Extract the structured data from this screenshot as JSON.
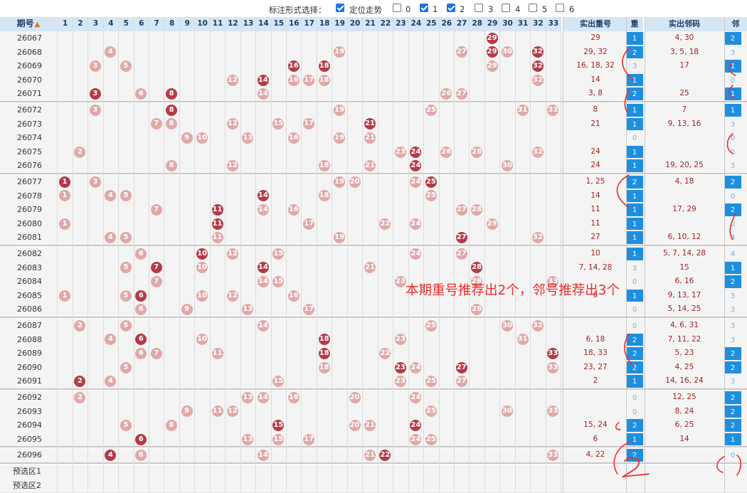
{
  "toolbar": {
    "label": "标注形式选择：",
    "options": [
      {
        "label": "定位走势",
        "checked": true
      },
      {
        "label": "0",
        "checked": false
      },
      {
        "label": "1",
        "checked": true
      },
      {
        "label": "2",
        "checked": true
      },
      {
        "label": "3",
        "checked": false
      },
      {
        "label": "4",
        "checked": false
      },
      {
        "label": "5",
        "checked": false
      },
      {
        "label": "6",
        "checked": false
      }
    ]
  },
  "header": {
    "period": "期号",
    "numbers": [
      "1",
      "2",
      "3",
      "4",
      "5",
      "6",
      "7",
      "8",
      "9",
      "10",
      "11",
      "12",
      "13",
      "14",
      "15",
      "16",
      "17",
      "18",
      "19",
      "20",
      "21",
      "22",
      "23",
      "24",
      "25",
      "26",
      "27",
      "28",
      "29",
      "30",
      "31",
      "32",
      "33"
    ],
    "repeat_nums": "实出重号",
    "repeat": "重",
    "adjacent_nums": "实出邻码",
    "adjacent": "邻"
  },
  "rows": [
    {
      "period": "26067",
      "light": [],
      "dark": [
        29
      ],
      "repeat_nums": "29",
      "repeat": "1",
      "adj_nums": "4, 30",
      "adj": "2",
      "group_end": false
    },
    {
      "period": "26068",
      "light": [
        4,
        19,
        27,
        30
      ],
      "dark": [
        29,
        32
      ],
      "repeat_nums": "29, 32",
      "repeat": "2",
      "adj_nums": "3, 5, 18",
      "adj": "3",
      "group_end": false
    },
    {
      "period": "26069",
      "light": [
        3,
        5,
        29
      ],
      "dark": [
        16,
        18,
        32
      ],
      "repeat_nums": "16, 18, 32",
      "repeat": "3",
      "adj_nums": "17",
      "adj": "1",
      "group_end": false
    },
    {
      "period": "26070",
      "light": [
        12,
        16,
        17,
        18,
        32
      ],
      "dark": [
        14
      ],
      "repeat_nums": "14",
      "repeat": "1",
      "adj_nums": "",
      "adj": "0",
      "group_end": false
    },
    {
      "period": "26071",
      "light": [
        6,
        14,
        26,
        27
      ],
      "dark": [
        3,
        8
      ],
      "repeat_nums": "3, 8",
      "repeat": "2",
      "adj_nums": "25",
      "adj": "1",
      "group_end": true
    },
    {
      "period": "26072",
      "light": [
        3,
        19,
        25,
        31,
        33
      ],
      "dark": [
        8
      ],
      "repeat_nums": "8",
      "repeat": "1",
      "adj_nums": "7",
      "adj": "1",
      "group_end": false
    },
    {
      "period": "26073",
      "light": [
        7,
        8,
        12,
        15,
        17
      ],
      "dark": [
        21
      ],
      "repeat_nums": "21",
      "repeat": "1",
      "adj_nums": "9, 13, 16",
      "adj": "3",
      "group_end": false
    },
    {
      "period": "26074",
      "light": [
        9,
        10,
        13,
        16,
        19,
        21
      ],
      "dark": [],
      "repeat_nums": "",
      "repeat": "0",
      "adj_nums": "",
      "adj": "0",
      "group_end": false
    },
    {
      "period": "26075",
      "light": [
        2,
        23,
        26,
        28,
        32
      ],
      "dark": [
        24
      ],
      "repeat_nums": "24",
      "repeat": "1",
      "adj_nums": "",
      "adj": "0",
      "group_end": false
    },
    {
      "period": "26076",
      "light": [
        8,
        12,
        18,
        21,
        30
      ],
      "dark": [
        24
      ],
      "repeat_nums": "24",
      "repeat": "1",
      "adj_nums": "19, 20, 25",
      "adj": "3",
      "group_end": true
    },
    {
      "period": "26077",
      "light": [
        3,
        19,
        20,
        24
      ],
      "dark": [
        1,
        25
      ],
      "repeat_nums": "1, 25",
      "repeat": "2",
      "adj_nums": "4, 18",
      "adj": "2",
      "group_end": false
    },
    {
      "period": "26078",
      "light": [
        1,
        4,
        5,
        18,
        25
      ],
      "dark": [
        14
      ],
      "repeat_nums": "14",
      "repeat": "1",
      "adj_nums": "",
      "adj": "0",
      "group_end": false
    },
    {
      "period": "26079",
      "light": [
        7,
        14,
        16,
        27,
        28
      ],
      "dark": [
        11
      ],
      "repeat_nums": "11",
      "repeat": "1",
      "adj_nums": "17, 29",
      "adj": "2",
      "group_end": false
    },
    {
      "period": "26080",
      "light": [
        1,
        17,
        22,
        24,
        29
      ],
      "dark": [
        11
      ],
      "repeat_nums": "11",
      "repeat": "1",
      "adj_nums": "",
      "adj": "0",
      "group_end": false
    },
    {
      "period": "26081",
      "light": [
        4,
        5,
        11,
        19,
        32
      ],
      "dark": [
        27
      ],
      "repeat_nums": "27",
      "repeat": "1",
      "adj_nums": "6, 10, 12",
      "adj": "3",
      "group_end": true
    },
    {
      "period": "26082",
      "light": [
        6,
        12,
        15,
        24,
        27
      ],
      "dark": [
        10
      ],
      "repeat_nums": "10",
      "repeat": "1",
      "adj_nums": "5, 7, 14, 28",
      "adj": "4",
      "group_end": false
    },
    {
      "period": "26083",
      "light": [
        5,
        10,
        21
      ],
      "dark": [
        7,
        14,
        28
      ],
      "repeat_nums": "7, 14, 28",
      "repeat": "3",
      "adj_nums": "15",
      "adj": "1",
      "group_end": false
    },
    {
      "period": "26084",
      "light": [
        7,
        14,
        15,
        23,
        28,
        33
      ],
      "dark": [],
      "repeat_nums": "",
      "repeat": "0",
      "adj_nums": "6, 16",
      "adj": "2",
      "group_end": false
    },
    {
      "period": "26085",
      "light": [
        1,
        5,
        10,
        12,
        16
      ],
      "dark": [
        6
      ],
      "repeat_nums": "6",
      "repeat": "1",
      "adj_nums": "9, 13, 17",
      "adj": "3",
      "group_end": false
    },
    {
      "period": "26086",
      "light": [
        6,
        9,
        13,
        17,
        28
      ],
      "dark": [],
      "repeat_nums": "",
      "repeat": "0",
      "adj_nums": "5, 14, 25",
      "adj": "3",
      "group_end": true
    },
    {
      "period": "26087",
      "light": [
        2,
        5,
        14,
        25,
        30,
        32
      ],
      "dark": [],
      "repeat_nums": "",
      "repeat": "0",
      "adj_nums": "4, 6, 31",
      "adj": "3",
      "group_end": false
    },
    {
      "period": "26088",
      "light": [
        4,
        10,
        23,
        31
      ],
      "dark": [
        6,
        18
      ],
      "repeat_nums": "6, 18",
      "repeat": "2",
      "adj_nums": "7, 11, 22",
      "adj": "3",
      "group_end": false
    },
    {
      "period": "26089",
      "light": [
        6,
        7,
        11,
        22
      ],
      "dark": [
        18,
        33
      ],
      "repeat_nums": "18, 33",
      "repeat": "2",
      "adj_nums": "5, 23",
      "adj": "2",
      "group_end": false
    },
    {
      "period": "26090",
      "light": [
        5,
        18,
        24,
        33
      ],
      "dark": [
        23,
        27
      ],
      "repeat_nums": "23, 27",
      "repeat": "2",
      "adj_nums": "4, 25",
      "adj": "2",
      "group_end": false
    },
    {
      "period": "26091",
      "light": [
        4,
        15,
        23,
        25,
        27
      ],
      "dark": [
        2
      ],
      "repeat_nums": "2",
      "repeat": "1",
      "adj_nums": "14, 16, 24",
      "adj": "3",
      "group_end": true
    },
    {
      "period": "26092",
      "light": [
        2,
        13,
        14,
        16,
        20,
        24
      ],
      "dark": [],
      "repeat_nums": "",
      "repeat": "0",
      "adj_nums": "12, 25",
      "adj": "2",
      "group_end": false
    },
    {
      "period": "26093",
      "light": [
        9,
        11,
        12,
        25,
        30,
        33
      ],
      "dark": [],
      "repeat_nums": "",
      "repeat": "0",
      "adj_nums": "8, 24",
      "adj": "2",
      "group_end": false
    },
    {
      "period": "26094",
      "light": [
        5,
        8,
        20,
        21
      ],
      "dark": [
        15,
        24
      ],
      "repeat_nums": "15, 24",
      "repeat": "2",
      "adj_nums": "6, 25",
      "adj": "2",
      "group_end": false
    },
    {
      "period": "26095",
      "light": [
        13,
        15,
        17,
        24,
        25
      ],
      "dark": [
        6
      ],
      "repeat_nums": "6",
      "repeat": "1",
      "adj_nums": "14",
      "adj": "1",
      "group_end": true
    },
    {
      "period": "26096",
      "light": [
        6,
        14,
        21,
        33
      ],
      "dark": [
        4,
        22
      ],
      "repeat_nums": "4, 22",
      "repeat": "2",
      "adj_nums": "",
      "adj": "0",
      "group_end": true
    }
  ],
  "preselect": [
    "预选区1",
    "预选区2"
  ],
  "annotation": "本期重号推荐出2个，邻号推荐出3个",
  "colors": {
    "ball_dark": "#b53a48",
    "ball_light": "#e0a8a8",
    "badge": "#1e8fdf",
    "annotation": "#ee2c2c",
    "header_bg": "#d7e6f5"
  }
}
